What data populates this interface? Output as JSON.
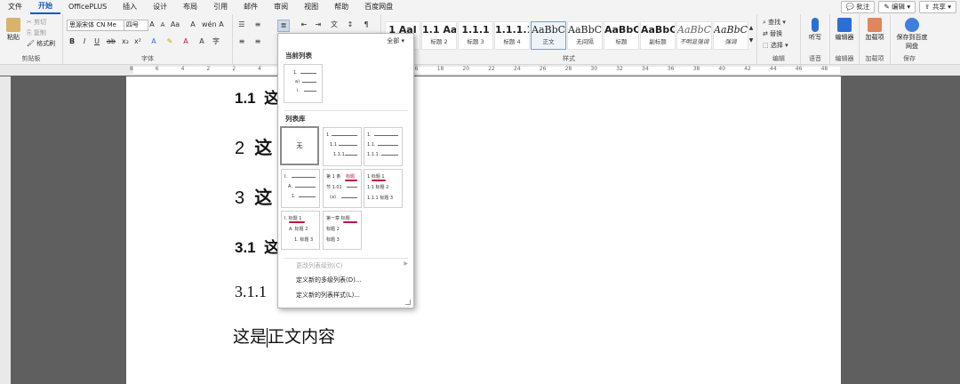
{
  "menu": {
    "tabs": [
      "文件",
      "开始",
      "OfficePLUS",
      "插入",
      "设计",
      "布局",
      "引用",
      "邮件",
      "审阅",
      "视图",
      "帮助",
      "百度网盘"
    ],
    "active_index": 1,
    "right": {
      "comment": "批注",
      "edit": "编辑",
      "share": "共享"
    }
  },
  "ribbon": {
    "clipboard": {
      "paste": "粘贴",
      "cut": "剪切",
      "copy": "复制",
      "format_painter": "格式刷",
      "label": "剪贴板"
    },
    "font": {
      "name": "思源宋体 CN Me",
      "size": "四号",
      "label": "字体"
    },
    "paragraph": {
      "label": "段落"
    },
    "styles": {
      "label": "样式",
      "items": [
        {
          "preview": "1 AaI",
          "name": "标题 1"
        },
        {
          "preview": "1.1 Aa",
          "name": "标题 2"
        },
        {
          "preview": "1.1.1",
          "name": "标题 3"
        },
        {
          "preview": "1.1.1.1",
          "name": "标题 4"
        },
        {
          "preview": "AaBbC",
          "name": "正文"
        },
        {
          "preview": "AaBbC",
          "name": "无间隔"
        },
        {
          "preview": "AaBbC",
          "name": "标题"
        },
        {
          "preview": "AaBbC",
          "name": "副标题"
        },
        {
          "preview": "AaBbC",
          "name": "不明显强调"
        },
        {
          "preview": "AaBbC",
          "name": "强调"
        }
      ]
    },
    "editing": {
      "find": "查找",
      "replace": "替换",
      "select": "选择",
      "label": "编辑"
    },
    "voice": {
      "dictate": "听写",
      "label": "语音"
    },
    "editor": {
      "btn": "编辑器",
      "label": "编辑器"
    },
    "addins": {
      "btn": "加载项",
      "label": "加载项"
    },
    "save": {
      "btn": "保存到百度网盘",
      "label": "保存"
    }
  },
  "ruler": {
    "numbers": [
      "8",
      "6",
      "4",
      "2",
      "2",
      "4",
      "6",
      "8",
      "10",
      "12",
      "14",
      "16",
      "18",
      "20",
      "22",
      "24",
      "26",
      "28",
      "30",
      "32",
      "34",
      "36",
      "38",
      "40",
      "42",
      "44",
      "46",
      "48"
    ]
  },
  "document": {
    "h1a": "1.1",
    "h1a_tail": "这",
    "h2a": "2",
    "h2a_tail": "这",
    "h2b": "3",
    "h2b_tail": "这",
    "h1b": "3.1",
    "h1b_tail": "这",
    "h3": "3.1.1",
    "body_before": "这是",
    "body_after": "正文内容"
  },
  "list_panel": {
    "all": "全部",
    "current_title": "当前列表",
    "library_title": "列表库",
    "none_label": "无",
    "thumbs": {
      "current": [
        "1.",
        "a)",
        "i."
      ],
      "lib1": [
        "1",
        "1.1",
        "1.1.1"
      ],
      "lib2": [
        "1.",
        "1.1.",
        "1.1.1."
      ],
      "lib3": [
        "I.",
        "A.",
        "1."
      ],
      "lib4": [
        "第 1 条",
        "节 1.01",
        "(a)"
      ],
      "lib4_tag": "标题",
      "lib5": [
        "1 标题 1",
        "1.1 标题 2",
        "1.1.1 标题 3"
      ],
      "lib6": [
        "I. 标题 1",
        "A. 标题 2",
        "1. 标题 3"
      ],
      "lib7": [
        "第一章 标题",
        "标题 2",
        "标题 3"
      ]
    },
    "menu": [
      {
        "label": "更改列表级别(C)",
        "disabled": true
      },
      {
        "label": "定义新的多级列表(D)...",
        "disabled": false
      },
      {
        "label": "定义新的列表样式(L)...",
        "disabled": false
      }
    ]
  },
  "colors": {
    "accent": "#185abd",
    "highlight": "#c0143c"
  }
}
